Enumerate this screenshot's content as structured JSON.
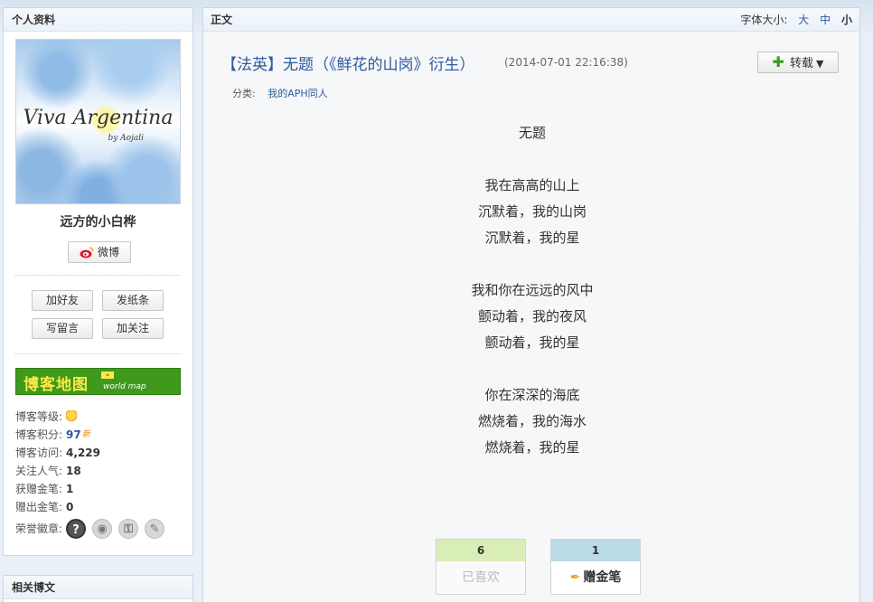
{
  "sidebar": {
    "profile_title": "个人资料",
    "avatar": {
      "main_text": "Viva Argentina",
      "sub_text": "by Aojali"
    },
    "username": "远方的小白桦",
    "weibo_label": "微博",
    "actions": [
      "加好友",
      "发纸条",
      "写留言",
      "加关注"
    ],
    "blog_map": {
      "label": "博客地图",
      "sub": "world map"
    },
    "stats": [
      {
        "label": "博客等级:",
        "value": ""
      },
      {
        "label": "博客积分:",
        "value": "97"
      },
      {
        "label": "博客访问:",
        "value": "4,229"
      },
      {
        "label": "关注人气:",
        "value": "18"
      },
      {
        "label": "获赠金笔:",
        "value": "1"
      },
      {
        "label": "赠出金笔:",
        "value": "0"
      },
      {
        "label": "荣誉徽章:",
        "value": ""
      }
    ],
    "related_title": "相关博文"
  },
  "main": {
    "section_title": "正文",
    "font_size_label": "字体大小:",
    "font_sizes": [
      "大",
      "中",
      "小"
    ],
    "post": {
      "title": "【法英】无题（《鲜花的山岗》衍生）",
      "time": "(2014-07-01 22:16:38)",
      "repost_label": "转载",
      "category_label": "分类:",
      "category_value": "我的APH同人",
      "poem": [
        "无题",
        "",
        "我在高高的山上",
        "沉默着，我的山岗",
        "沉默着，我的星",
        "",
        "我和你在远远的风中",
        "颤动着，我的夜风",
        "颤动着，我的星",
        "",
        "你在深深的海底",
        "燃烧着，我的海水",
        "燃烧着，我的星"
      ]
    },
    "like": {
      "count": "6",
      "label": "已喜欢"
    },
    "gold_pen": {
      "count": "1",
      "label": "赠金笔"
    }
  },
  "colors": {
    "link": "#2d5aa0",
    "like_bar": "#d9eeb7",
    "gold_bar": "#b9dbe6",
    "blog_map_bg": "#3f9a1c"
  }
}
